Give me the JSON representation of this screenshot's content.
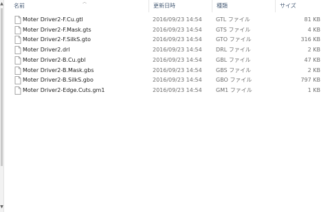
{
  "columns": {
    "name": "名前",
    "date": "更新日時",
    "type": "種類",
    "size": "サイズ"
  },
  "files": [
    {
      "name": "Moter Driver2-F.Cu.gtl",
      "date": "2016/09/23 14:54",
      "type": "GTL ファイル",
      "size": "81 KB"
    },
    {
      "name": "Moter Driver2-F.Mask.gts",
      "date": "2016/09/23 14:54",
      "type": "GTS ファイル",
      "size": "4 KB"
    },
    {
      "name": "Moter Driver2-F.SilkS.gto",
      "date": "2016/09/23 14:54",
      "type": "GTO ファイル",
      "size": "316 KB"
    },
    {
      "name": "Moter Driver2.drl",
      "date": "2016/09/23 14:54",
      "type": "DRL ファイル",
      "size": "2 KB"
    },
    {
      "name": "Moter Driver2-B.Cu.gbl",
      "date": "2016/09/23 14:54",
      "type": "GBL ファイル",
      "size": "47 KB"
    },
    {
      "name": "Moter Driver2-B.Mask.gbs",
      "date": "2016/09/23 14:54",
      "type": "GBS ファイル",
      "size": "2 KB"
    },
    {
      "name": "Moter Driver2-B.SilkS.gbo",
      "date": "2016/09/23 14:54",
      "type": "GBO ファイル",
      "size": "797 KB"
    },
    {
      "name": "Moter Driver2-Edge.Cuts.gm1",
      "date": "2016/09/23 14:54",
      "type": "GM1 ファイル",
      "size": "1 KB"
    }
  ],
  "icons": {
    "file": "generic-file-icon",
    "sort": "sort-ascending-icon",
    "scroll_up": "scroll-up-arrow-icon",
    "scroll_down": "scroll-down-arrow-icon"
  }
}
